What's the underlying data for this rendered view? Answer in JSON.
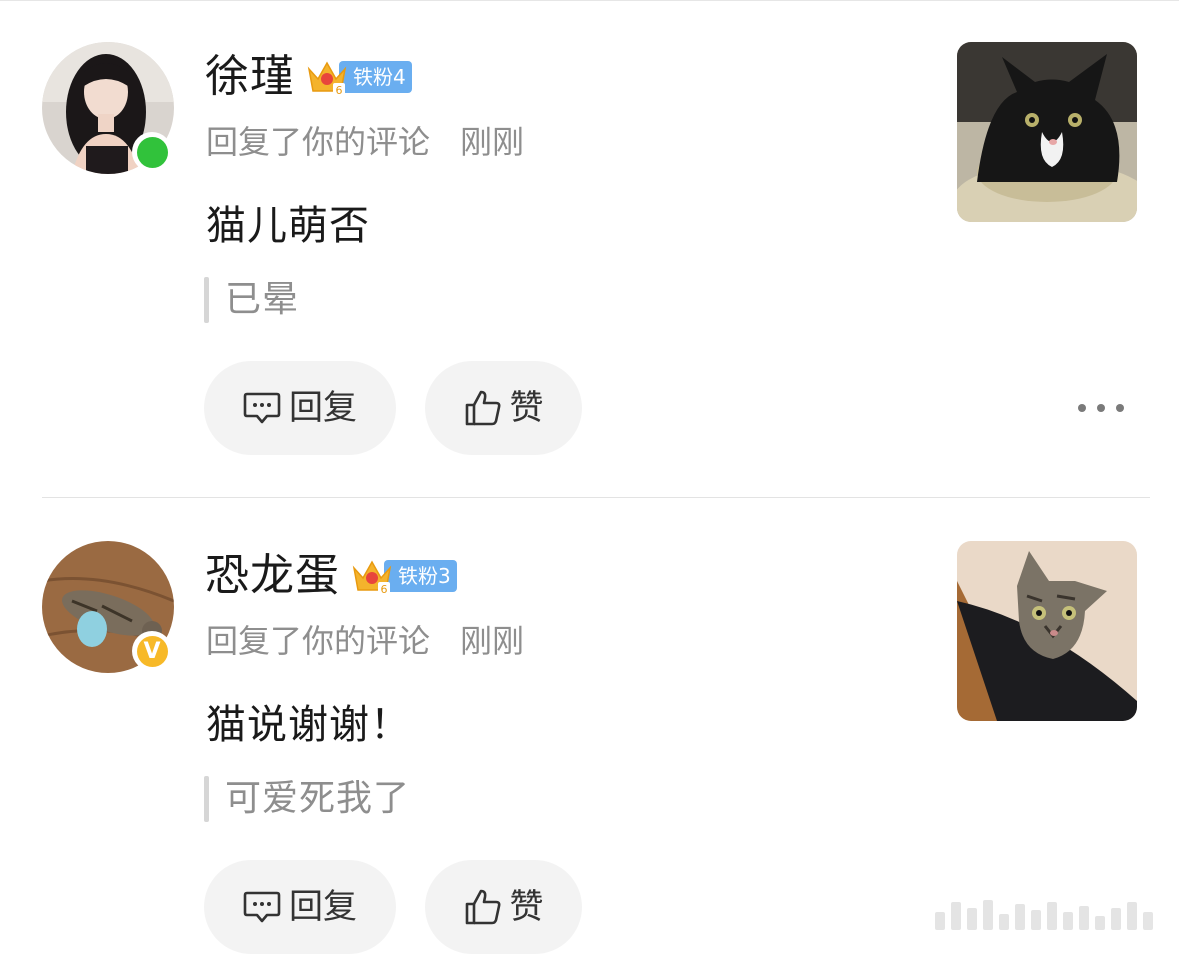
{
  "notifications": [
    {
      "user_name": "徐瑾",
      "fan_badge": "铁粉4",
      "crown_level": "6",
      "action": "回复了你的评论",
      "time": "刚刚",
      "comment": "猫儿萌否",
      "quoted": "已晕",
      "status": "online",
      "reply_label": "回复",
      "like_label": "赞"
    },
    {
      "user_name": "恐龙蛋",
      "fan_badge": "铁粉3",
      "crown_level": "6",
      "action": "回复了你的评论",
      "time": "刚刚",
      "comment": "猫说谢谢！",
      "quoted": "可爱死我了",
      "status": "verified",
      "verified_mark": "V",
      "reply_label": "回复",
      "like_label": "赞"
    }
  ],
  "colors": {
    "online": "#31c23b",
    "verified": "#f7b928",
    "fan_badge": "#6aaef0",
    "button_bg": "#f3f3f3",
    "meta_text": "#8e8e8e"
  },
  "icons": {
    "reply": "comment-bubble-icon",
    "like": "thumbs-up-icon",
    "more": "more-dots-icon",
    "fan": "crown-icon"
  }
}
